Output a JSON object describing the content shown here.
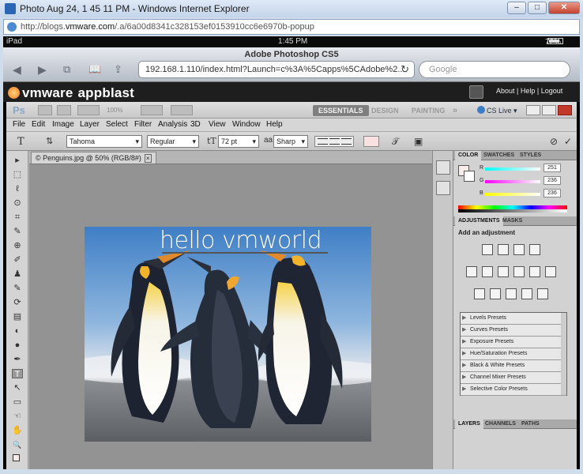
{
  "ie": {
    "title": "Photo Aug 24, 1 45 11 PM - Windows Internet Explorer",
    "url_prefix": "http://blogs.",
    "url_domain": "vmware.com",
    "url_rest": "/.a/6a00d8341c328153ef0153910cc6e6970b-popup",
    "min": "–",
    "max": "□",
    "close": "✕"
  },
  "ipad": {
    "device": "iPad",
    "time": "1:45 PM",
    "battery": "72%"
  },
  "safari": {
    "page_title": "Adobe Photoshop CS5",
    "back": "◀",
    "forward": "▶",
    "url": "192.168.1.110/index.html?Launch=c%3A%5Capps%5CAdobe%2...",
    "reload": "↻",
    "search_placeholder": "Google"
  },
  "appblast": {
    "brand1": "vmware",
    "brand2": "appblast",
    "links": "About | Help | Logout"
  },
  "ps": {
    "logo": "Ps",
    "zoom": "100%",
    "workspaces": [
      "ESSENTIALS",
      "DESIGN",
      "PAINTING"
    ],
    "more": "»",
    "cslive": "CS Live",
    "menu": [
      "File",
      "Edit",
      "Image",
      "Layer",
      "Select",
      "Filter",
      "Analysis",
      "3D",
      "View",
      "Window",
      "Help"
    ],
    "options": {
      "tool_icon": "T",
      "font_family": "Tahoma",
      "font_style": "Regular",
      "font_size": "72 pt",
      "aa_icon": "aa",
      "antialias": "Sharp",
      "cancel_icon": "⊘",
      "commit_icon": "✓"
    },
    "document_tab": "© Penguins.jpg @ 50% (RGB/8#)",
    "document_close": "×",
    "canvas_text": "hello vmworld",
    "tools": [
      "▸",
      "⬚",
      "ℓ",
      "⊙",
      "⌗",
      "✎",
      "⊕",
      "✐",
      "♟",
      "✎",
      "⟳",
      "▤",
      "◐",
      "●",
      "✒",
      "T",
      "↖",
      "▭",
      "☜",
      "✋",
      "🔍"
    ],
    "color_panel": {
      "tabs": [
        "COLOR",
        "SWATCHES",
        "STYLES"
      ],
      "channels": [
        {
          "label": "R",
          "value": "251"
        },
        {
          "label": "G",
          "value": "236"
        },
        {
          "label": "B",
          "value": "236"
        }
      ]
    },
    "adjustments_panel": {
      "tabs": [
        "ADJUSTMENTS",
        "MASKS"
      ],
      "heading": "Add an adjustment",
      "presets": [
        "Levels Presets",
        "Curves Presets",
        "Exposure Presets",
        "Hue/Saturation Presets",
        "Black & White Presets",
        "Channel Mixer Presets",
        "Selective Color Presets"
      ]
    },
    "layers_panel": {
      "tabs": [
        "LAYERS",
        "CHANNELS",
        "PATHS"
      ]
    }
  },
  "colors": {
    "foreground": "#fbecec",
    "ps_chrome": "#b3b3b3",
    "vmware_bar": "#1e1e1e"
  }
}
